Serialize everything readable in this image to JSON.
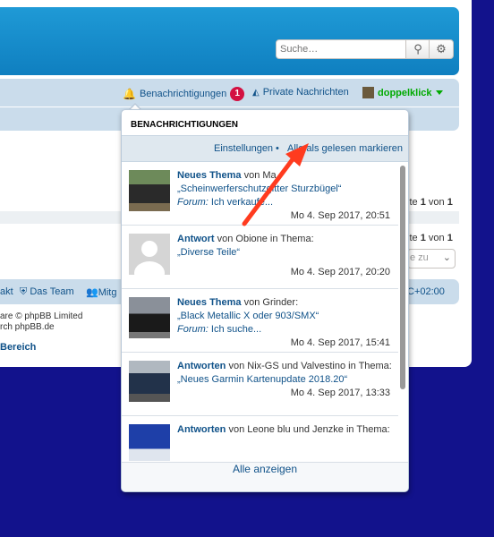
{
  "search": {
    "placeholder": "Suche…"
  },
  "navbar": {
    "notifications_label": "Benachrichtigungen",
    "notifications_count": "1",
    "private_messages_label": "Private Nachrichten",
    "username": "doppelklick"
  },
  "background": {
    "page_label": "ite",
    "page_num": "1",
    "page_of": "von",
    "page_total": "1",
    "page_label2": "ite",
    "page_num2": "1",
    "page_of2": "von",
    "page_total2": "1",
    "jump_label": "e zu",
    "footer_links": [
      "akt",
      "Das Team",
      "Mitg"
    ],
    "timezone": "C+02:00",
    "copyright_line1": "are © phpBB Limited",
    "copyright_line2": "rch phpBB.de",
    "admin_link": "Bereich"
  },
  "dropdown": {
    "title": "Benachrichtigungen",
    "settings_link": "Einstellungen",
    "bullet": "•",
    "mark_read_link": "Alle als gelesen markieren",
    "show_all": "Alle anzeigen",
    "items": [
      {
        "type": "Neues Thema",
        "by": "von Ma",
        "quote": "„Scheinwerferschutzgitter Sturzbügel“",
        "forum_label": "Forum:",
        "forum_text": "Ich verkaufe...",
        "date": "Mo 4. Sep 2017, 20:51"
      },
      {
        "type": "Antwort",
        "by": "von Obione in Thema:",
        "quote": "„Diverse Teile“",
        "date": "Mo 4. Sep 2017, 20:20"
      },
      {
        "type": "Neues Thema",
        "by": "von Grinder:",
        "quote": "„Black Metallic X oder 903/SMX“",
        "forum_label": "Forum:",
        "forum_text": "Ich suche...",
        "date": "Mo 4. Sep 2017, 15:41"
      },
      {
        "type": "Antworten",
        "by": "von Nix-GS und Valvestino in Thema:",
        "quote": "„Neues Garmin Kartenupdate 2018.20“",
        "date": "Mo 4. Sep 2017, 13:33"
      },
      {
        "type": "Antworten",
        "by": "von Leone blu und Jenzke in Thema:"
      }
    ]
  },
  "colors": {
    "accent": "#105289",
    "badge": "#d31141",
    "user": "#00aa00",
    "annotation_arrow": "#ff3b1f"
  }
}
